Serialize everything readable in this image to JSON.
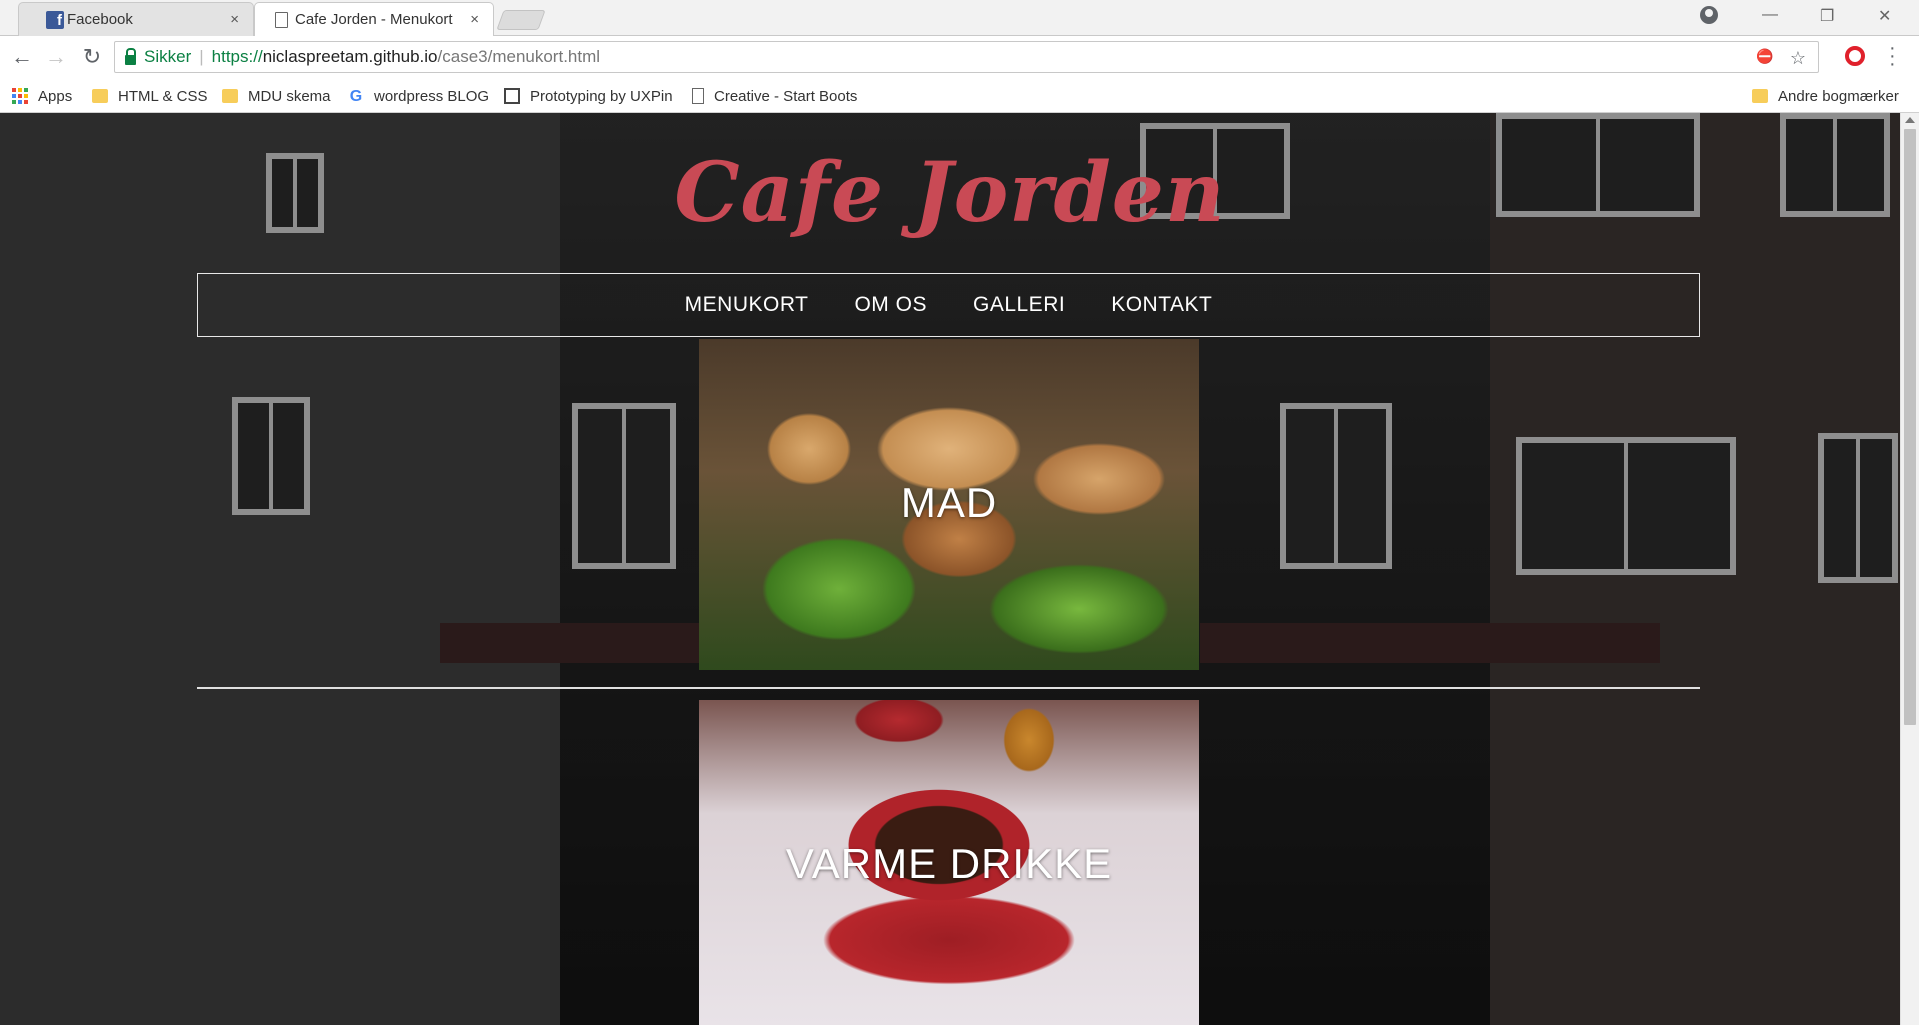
{
  "browser": {
    "tabs": [
      {
        "title": "Facebook",
        "icon": "facebook-icon",
        "active": false
      },
      {
        "title": "Cafe Jorden - Menukort",
        "icon": "page-icon",
        "active": true
      }
    ],
    "close_glyph": "×",
    "window_controls": {
      "minimize": "—",
      "restore": "❐",
      "close": "✕"
    },
    "nav": {
      "back": "←",
      "forward": "→",
      "reload": "↻"
    },
    "address": {
      "secure_label": "Sikker",
      "url_scheme": "https://",
      "url_host": "niclaspreetam.github.io",
      "url_path": "/case3/menukort.html"
    },
    "omni_icons": {
      "cookie": "⛔",
      "star": "☆"
    },
    "bookmarks": [
      {
        "label": "Apps",
        "icon": "apps-grid-icon"
      },
      {
        "label": "HTML & CSS",
        "icon": "folder-icon"
      },
      {
        "label": "MDU skema",
        "icon": "folder-icon"
      },
      {
        "label": "wordpress BLOG",
        "icon": "google-icon"
      },
      {
        "label": "Prototyping by UXPin",
        "icon": "square-icon"
      },
      {
        "label": "Creative - Start Boots",
        "icon": "page-icon"
      }
    ],
    "other_bookmarks": {
      "label": "Andre bogmærker",
      "icon": "folder-icon"
    },
    "apps_colors": [
      "#ea4335",
      "#fbbc05",
      "#34a853",
      "#4285f4",
      "#ea4335",
      "#fbbc05",
      "#34a853",
      "#4285f4",
      "#ea4335"
    ]
  },
  "site": {
    "brand": "Cafe Jorden",
    "brand_color": "#c94a55",
    "nav": [
      {
        "label": "MENUKORT"
      },
      {
        "label": "OM OS"
      },
      {
        "label": "GALLERI"
      },
      {
        "label": "KONTAKT"
      }
    ],
    "cards": [
      {
        "title": "MAD"
      },
      {
        "title": "VARME DRIKKE"
      }
    ]
  }
}
